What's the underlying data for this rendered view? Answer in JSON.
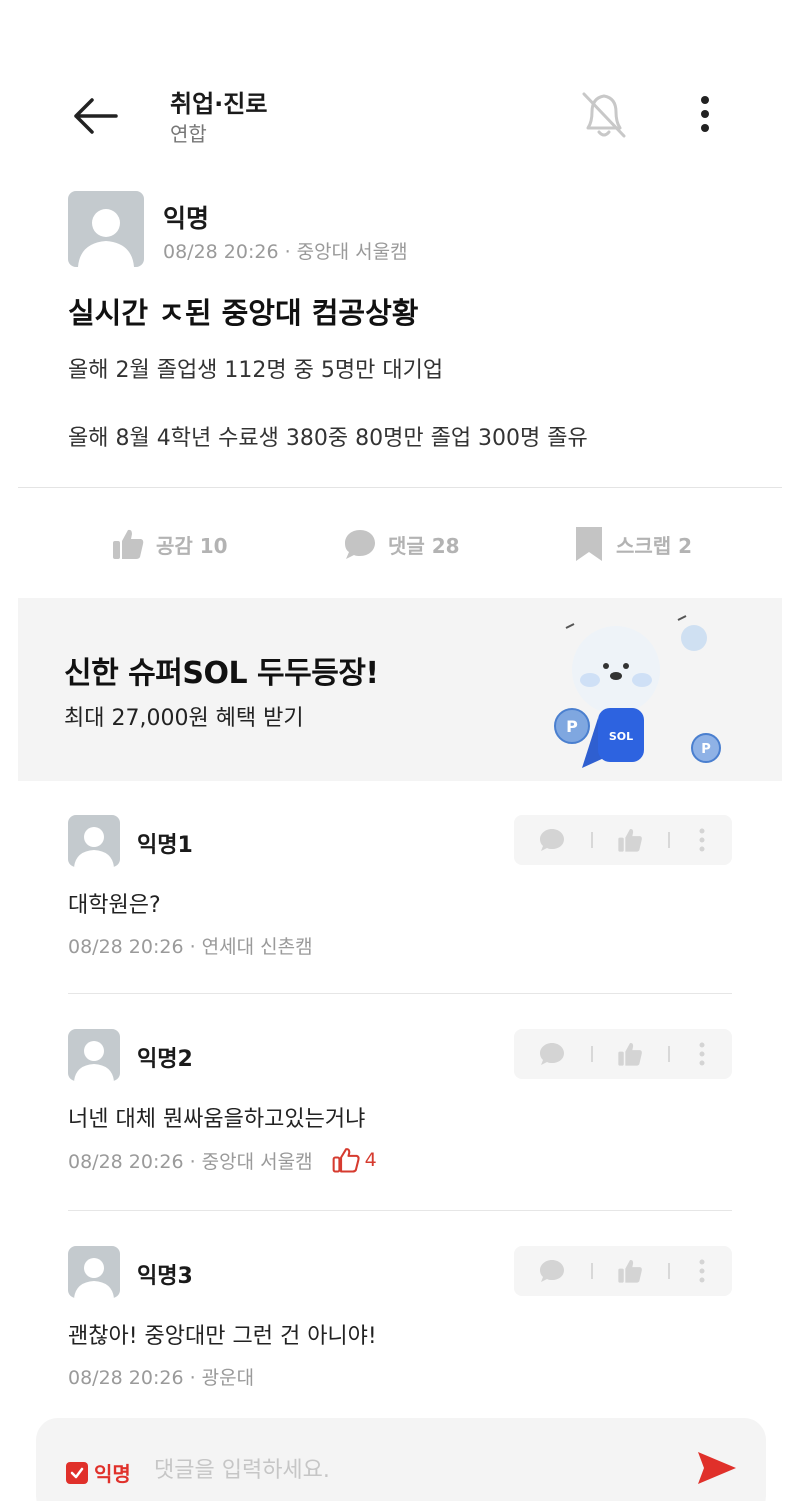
{
  "header": {
    "title": "취업·진로",
    "subtitle": "연합"
  },
  "post": {
    "author": "익명",
    "meta": "08/28 20:26 · 중앙대 서울캠",
    "title": "실시간 ㅈ된 중앙대 컴공상황",
    "body": [
      "올해 2월 졸업생 112명 중 5명만 대기업",
      "올해 8월 4학년 수료생 380중 80명만 졸업 300명 졸유"
    ]
  },
  "actions": {
    "like": "공감 10",
    "comment": "댓글 28",
    "scrap": "스크랩 2"
  },
  "ad": {
    "title": "신한 슈퍼SOL 두두등장!",
    "subtitle": "최대 27,000원 혜택 받기",
    "mascot_badge": "SOL",
    "coin_label": "P"
  },
  "comments": [
    {
      "name": "익명1",
      "text": "대학원은?",
      "meta": "08/28 20:26 · 연세대 신촌캠",
      "likes": ""
    },
    {
      "name": "익명2",
      "text": "너넨 대체 뭔싸움을하고있는거냐",
      "meta": "08/28 20:26 · 중앙대 서울캠",
      "likes": "4"
    },
    {
      "name": "익명3",
      "text": "괜찮아! 중앙대만 그런 건 아니야!",
      "meta": "08/28 20:26 · 광운대",
      "likes": ""
    }
  ],
  "input": {
    "anonymous_label": "익명",
    "placeholder": "댓글을 입력하세요."
  },
  "colors": {
    "accent": "#e0302a",
    "muted": "#b3b3b3",
    "ad_bg": "#f4f4f4"
  }
}
